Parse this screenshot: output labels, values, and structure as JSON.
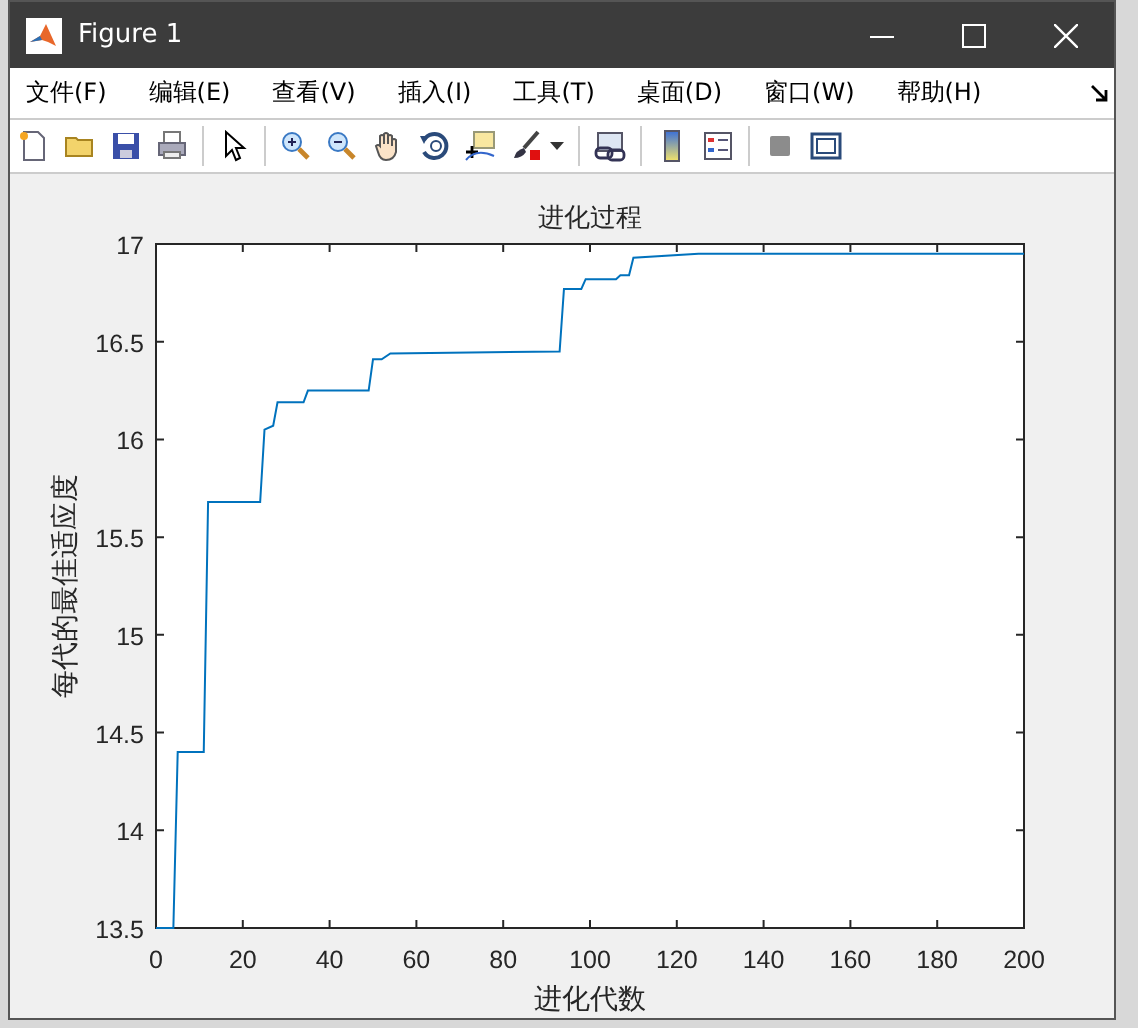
{
  "window": {
    "title": "Figure 1"
  },
  "menu": [
    "文件(F)",
    "编辑(E)",
    "查看(V)",
    "插入(I)",
    "工具(T)",
    "桌面(D)",
    "窗口(W)",
    "帮助(H)"
  ],
  "chart_data": {
    "type": "line",
    "title": "进化过程",
    "xlabel": "进化代数",
    "ylabel": "每代的最佳适应度",
    "x": [
      0,
      4,
      5,
      11,
      12,
      24,
      25,
      27,
      28,
      34,
      35,
      49,
      50,
      52,
      54,
      93,
      94,
      98,
      99,
      106,
      107,
      109,
      110,
      125,
      200
    ],
    "series": [
      {
        "color": "#0072bd",
        "values": [
          13.5,
          13.5,
          14.4,
          14.4,
          15.68,
          15.68,
          16.05,
          16.07,
          16.19,
          16.19,
          16.25,
          16.25,
          16.41,
          16.41,
          16.44,
          16.45,
          16.77,
          16.77,
          16.82,
          16.82,
          16.84,
          16.84,
          16.93,
          16.95,
          16.95
        ]
      }
    ],
    "xlim": [
      0,
      200
    ],
    "ylim": [
      13.5,
      17
    ],
    "xticks": [
      0,
      20,
      40,
      60,
      80,
      100,
      120,
      140,
      160,
      180,
      200
    ],
    "yticks": [
      13.5,
      14,
      14.5,
      15,
      15.5,
      16,
      16.5,
      17
    ]
  }
}
